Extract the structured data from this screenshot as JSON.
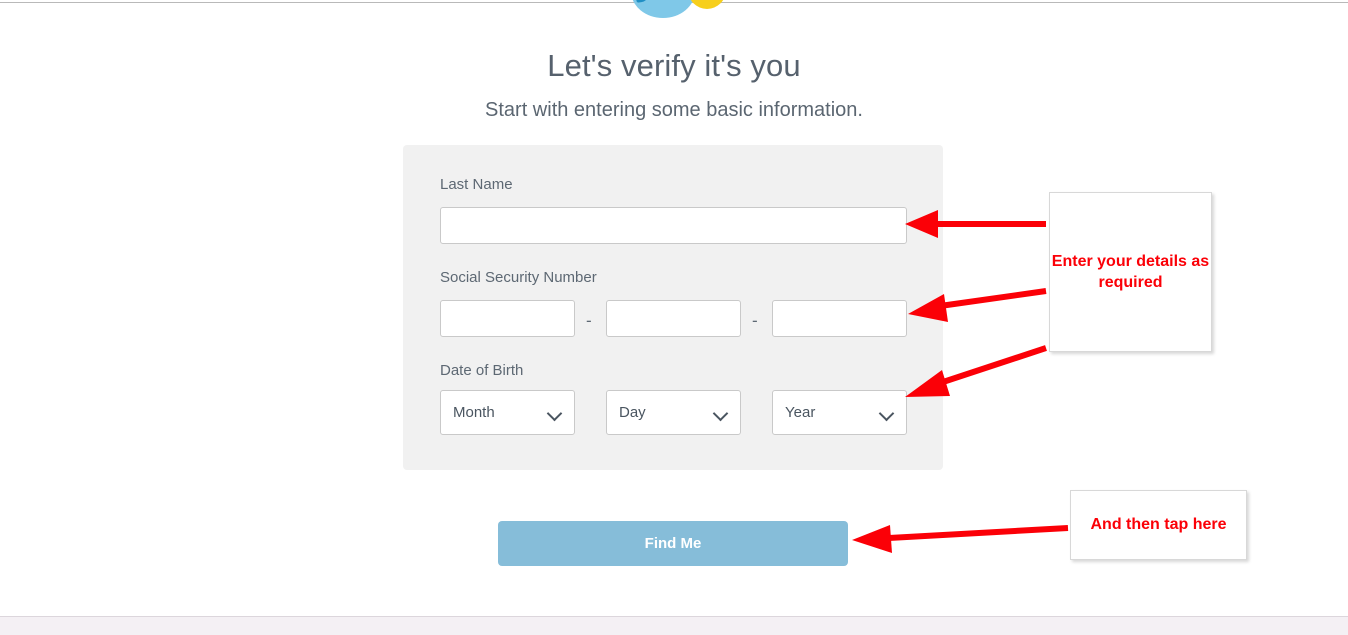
{
  "page": {
    "heading": "Let's verify it's you",
    "subheading": "Start with entering some basic information."
  },
  "logo": {
    "badge_glyph": "!",
    "blob_color": "#7fc8e8",
    "badge_color": "#f7cf1c"
  },
  "form": {
    "last_name": {
      "label": "Last Name",
      "value": "",
      "placeholder": ""
    },
    "ssn": {
      "label": "Social Security Number",
      "separator": "-",
      "parts": [
        {
          "value": "",
          "placeholder": ""
        },
        {
          "value": "",
          "placeholder": ""
        },
        {
          "value": "",
          "placeholder": ""
        }
      ]
    },
    "dob": {
      "label": "Date of Birth",
      "selects": [
        {
          "selected": "Month"
        },
        {
          "selected": "Day"
        },
        {
          "selected": "Year"
        }
      ]
    }
  },
  "actions": {
    "submit_label": "Find Me",
    "submit_color": "#86bdd9"
  },
  "annotations": {
    "color": "#fb0007",
    "details_note": "Enter your details as required",
    "tap_note": "And then tap here"
  }
}
